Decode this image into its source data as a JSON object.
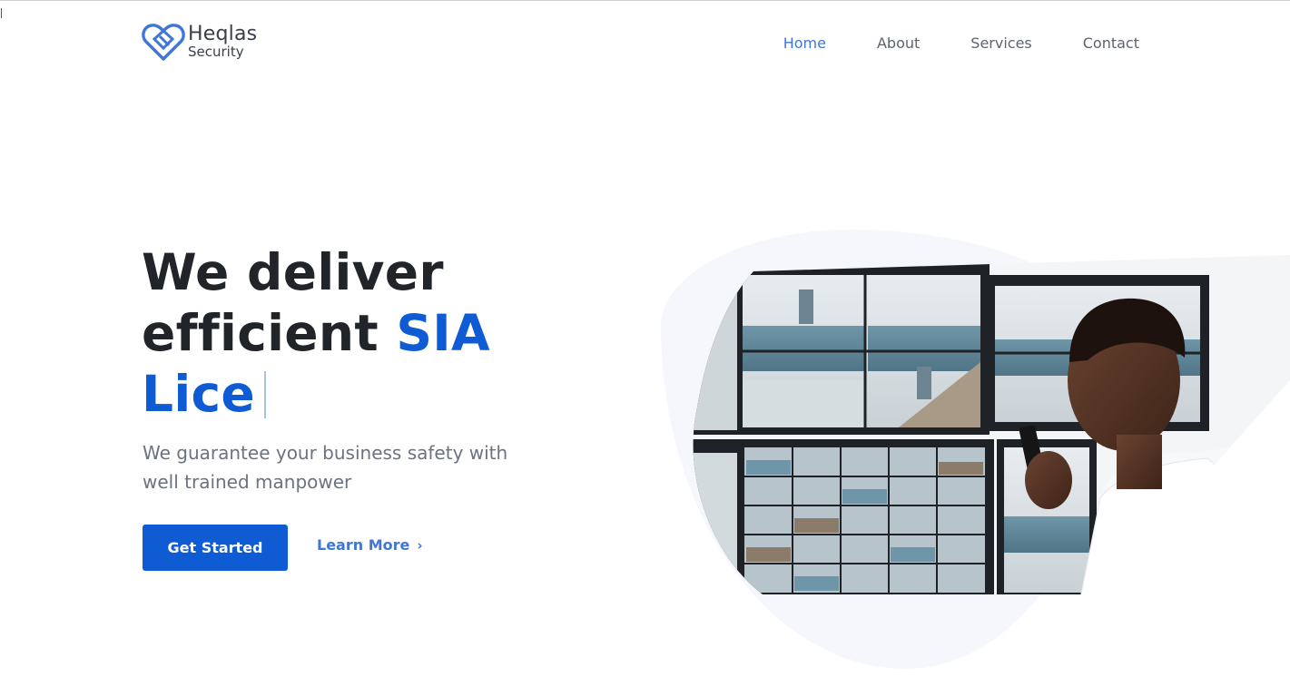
{
  "brand": {
    "name": "Heqlas",
    "subtitle": "Security",
    "accent_color": "#0e5bd4",
    "logo_icon": "heart-shield-icon"
  },
  "nav": {
    "items": [
      {
        "label": "Home",
        "active": true
      },
      {
        "label": "About",
        "active": false
      },
      {
        "label": "Services",
        "active": false
      },
      {
        "label": "Contact",
        "active": false
      }
    ]
  },
  "hero": {
    "title_line1": "We deliver",
    "title_line2_plain": "efficient",
    "title_line2_highlight": "SIA",
    "title_line3_highlight": "Lice",
    "subtitle": "We guarantee your business safety with well trained manpower",
    "primary_button": "Get Started",
    "secondary_link": "Learn More",
    "secondary_icon": "chevron-right-icon",
    "image_alt": "security-operator-monitoring-cctv-image"
  }
}
